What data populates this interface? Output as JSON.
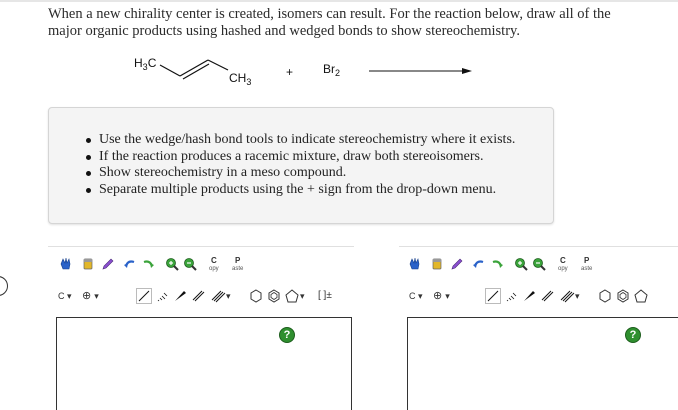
{
  "question": {
    "prompt": "When a new chirality center is created, isomers can result. For the reaction below, draw all of the major organic products using hashed and wedged bonds to show stereochemistry."
  },
  "reaction": {
    "reactant_left_label": "H3C",
    "reactant_right_label": "CH3",
    "plus": "+",
    "reagent": "Br2"
  },
  "instructions": [
    "Use the wedge/hash bond tools to indicate stereochemistry where it exists.",
    "If the reaction produces a racemic mixture, draw both stereoisomers.",
    "Show stereochemistry in a meso compound.",
    "Separate multiple products using the + sign from the drop-down menu."
  ],
  "editor_left": {
    "copy_label": "C",
    "copy_sub": "opy",
    "paste_label": "P",
    "paste_sub": "aste",
    "element": "C",
    "bracket_label": "[ ]±",
    "help": "?"
  },
  "editor_right": {
    "copy_label": "C",
    "copy_sub": "opy",
    "paste_label": "P",
    "paste_sub": "aste",
    "element": "C",
    "help": "?"
  },
  "colors": {
    "help_green": "#2f8f2f",
    "tool_blue": "#2a62c9",
    "tool_purple": "#8a4fd0",
    "tool_yellow": "#e2b72a",
    "tool_green": "#3aa33a"
  },
  "icons": [
    "hand-icon",
    "eraser-icon",
    "pencil-icon",
    "undo-icon",
    "redo-icon",
    "zoom-in-icon",
    "zoom-out-icon",
    "copy-icon",
    "paste-icon",
    "single-bond-icon",
    "hash-bond-icon",
    "wedge-bond-icon",
    "double-bond-icon",
    "triple-bond-icon",
    "ring-icon",
    "help-icon"
  ]
}
